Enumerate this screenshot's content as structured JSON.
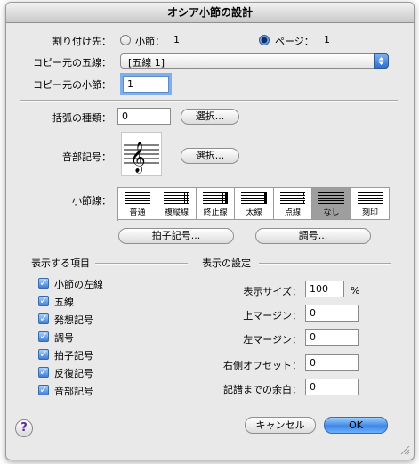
{
  "window": {
    "title": "オシア小節の設計"
  },
  "assign": {
    "label": "割り付け先：",
    "measure_label": "小節：",
    "measure_value": "1",
    "page_label": "ページ：",
    "page_value": "1",
    "selected": "page"
  },
  "source_staff": {
    "label": "コピー元の五線：",
    "value": "[五線 1]"
  },
  "source_measure": {
    "label": "コピー元の小節：",
    "value": "1"
  },
  "bracket": {
    "label": "括弧の種類：",
    "value": "0",
    "button": "選択..."
  },
  "clef": {
    "label": "音部記号：",
    "button": "選択..."
  },
  "barline": {
    "label": "小節線：",
    "options": [
      {
        "name": "普通"
      },
      {
        "name": "複縦線"
      },
      {
        "name": "終止線"
      },
      {
        "name": "太線"
      },
      {
        "name": "点線"
      },
      {
        "name": "なし"
      },
      {
        "name": "刻印"
      }
    ],
    "selected_index": 5
  },
  "buttons": {
    "time_sig": "拍子記号...",
    "key_sig": "調号..."
  },
  "show_items": {
    "header": "表示する項目",
    "items": [
      {
        "label": "小節の左線",
        "checked": true
      },
      {
        "label": "五線",
        "checked": true
      },
      {
        "label": "発想記号",
        "checked": true
      },
      {
        "label": "調号",
        "checked": true
      },
      {
        "label": "拍子記号",
        "checked": true
      },
      {
        "label": "反復記号",
        "checked": true
      },
      {
        "label": "音部記号",
        "checked": true
      }
    ]
  },
  "display_settings": {
    "header": "表示の設定",
    "size_label": "表示サイズ：",
    "size_value": "100",
    "size_unit": "%",
    "top_margin_label": "上マージン：",
    "top_margin_value": "0",
    "left_margin_label": "左マージン：",
    "left_margin_value": "0",
    "right_offset_label": "右側オフセット：",
    "right_offset_value": "0",
    "staff_margin_label": "記譜までの余白：",
    "staff_margin_value": "0"
  },
  "footer": {
    "cancel": "キャンセル",
    "ok": "OK",
    "help": "?"
  }
}
